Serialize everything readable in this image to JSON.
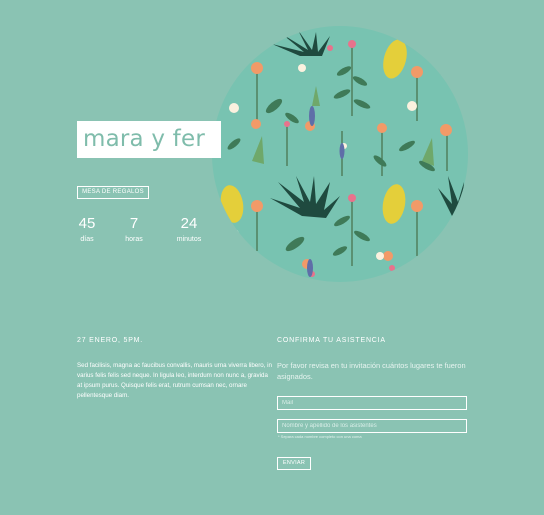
{
  "header": {
    "title": "mara y fer",
    "registry_label": "MESA DE REGALOS"
  },
  "countdown": [
    {
      "value": "45",
      "unit": "días"
    },
    {
      "value": "7",
      "unit": "horas"
    },
    {
      "value": "24",
      "unit": "minutos"
    }
  ],
  "event": {
    "heading": "27 ENERO, 5PM.",
    "body": "Sed facilisis, magna ac faucibus convallis, mauris urna viverra libero, in varius felis felis sed neque. In ligula leo, interdum non nunc a, gravida at ipsum purus. Quisque felis erat, rutrum cumsan nec, ornare pellentesque diam."
  },
  "rsvp": {
    "heading": "CONFIRMA TU ASISTENCIA",
    "intro": "Por favor revisa en tu invitación cuántos lugares te fueron asignados.",
    "email_placeholder": "Mail",
    "names_placeholder": "Nombre y apellido de los asistentes",
    "names_hint": "* Separa cada nombre completo con una coma",
    "send_label": "ENVIAR"
  },
  "colors": {
    "background": "#8ac3b3",
    "floral_background": "#78c3b1",
    "title_text": "#7fbcab"
  },
  "icons": [
    "floral-illustration"
  ]
}
